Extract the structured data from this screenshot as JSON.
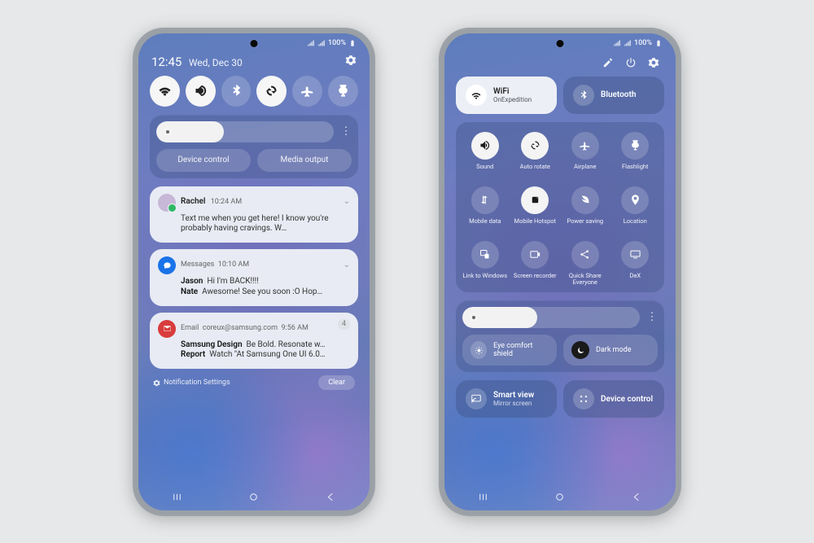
{
  "status": {
    "battery": "100%"
  },
  "left": {
    "time": "12:45",
    "date": "Wed, Dec 30",
    "quick_toggles": [
      {
        "name": "wifi",
        "active": true
      },
      {
        "name": "sound",
        "active": true
      },
      {
        "name": "bluetooth",
        "active": false
      },
      {
        "name": "rotate",
        "active": true
      },
      {
        "name": "airplane",
        "active": false
      },
      {
        "name": "flashlight",
        "active": false
      }
    ],
    "brightness_pct": 38,
    "pill_device": "Device control",
    "pill_media": "Media output",
    "notifications": [
      {
        "kind": "message",
        "name": "Rachel",
        "time": "10:24 AM",
        "body": "Text me when you get here! I know you're probably having cravings. W…"
      },
      {
        "kind": "app",
        "app": "Messages",
        "time": "10:10 AM",
        "count": "",
        "lines": [
          {
            "who": "Jason",
            "text": "Hi I'm BACK!!!!"
          },
          {
            "who": "Nate",
            "text": "Awesome! See you soon :O Hop…"
          }
        ]
      },
      {
        "kind": "email",
        "app": "Email",
        "from": "coreux@samsung.com",
        "time": "9:56 AM",
        "count": "4",
        "lines": [
          {
            "who": "Samsung Design",
            "text": "Be Bold. Resonate w…"
          },
          {
            "who": "Report",
            "text": "Watch \"At Samsung One UI 6.0…"
          }
        ]
      }
    ],
    "footer_settings": "Notification Settings",
    "footer_clear": "Clear"
  },
  "right": {
    "wifi": {
      "title": "WiFi",
      "sub": "OnExpedition"
    },
    "bluetooth": {
      "title": "Bluetooth",
      "sub": ""
    },
    "tiles": [
      {
        "name": "sound",
        "label": "Sound",
        "active": true
      },
      {
        "name": "rotate",
        "label": "Auto rotate",
        "active": true
      },
      {
        "name": "airplane",
        "label": "Airplane",
        "active": false
      },
      {
        "name": "flashlight",
        "label": "Flashlight",
        "active": false
      },
      {
        "name": "data",
        "label": "Mobile data",
        "active": false
      },
      {
        "name": "hotspot",
        "label": "Mobile Hotspot",
        "active": true
      },
      {
        "name": "power",
        "label": "Power saving",
        "active": false
      },
      {
        "name": "location",
        "label": "Location",
        "active": false
      },
      {
        "name": "link",
        "label": "Link to Windows",
        "active": false
      },
      {
        "name": "recorder",
        "label": "Screen recorder",
        "active": false
      },
      {
        "name": "share",
        "label": "Quick Share Everyone",
        "active": false
      },
      {
        "name": "dex",
        "label": "DeX",
        "active": false
      }
    ],
    "brightness_pct": 42,
    "eye": "Eye comfort shield",
    "dark": "Dark mode",
    "smartview": {
      "title": "Smart view",
      "sub": "Mirror screen"
    },
    "devicectl": "Device control"
  }
}
